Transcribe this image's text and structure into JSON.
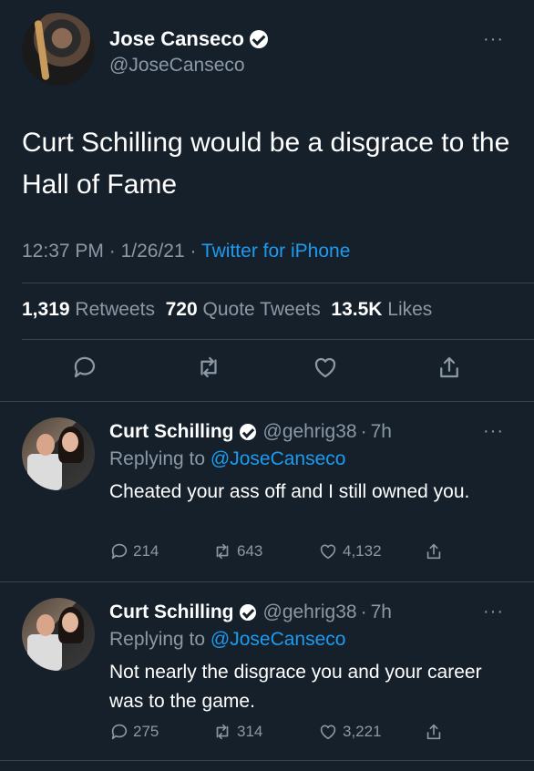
{
  "main_tweet": {
    "author_name": "Jose Canseco",
    "author_handle": "@JoseCanseco",
    "text": "Curt Schilling would be a disgrace to the Hall of Fame",
    "time": "12:37 PM",
    "date": "1/26/21",
    "source": "Twitter for iPhone",
    "separator": "·",
    "stats": {
      "retweets_count": "1,319",
      "retweets_label": "Retweets",
      "quotes_count": "720",
      "quotes_label": "Quote Tweets",
      "likes_count": "13.5K",
      "likes_label": "Likes"
    }
  },
  "replies": [
    {
      "author_name": "Curt Schilling",
      "author_handle": "@gehrig38",
      "age": "7h",
      "replying_prefix": "Replying to",
      "replying_to": "@JoseCanseco",
      "text": "Cheated your ass off and I still owned you.",
      "replies": "214",
      "retweets": "643",
      "likes": "4,132"
    },
    {
      "author_name": "Curt Schilling",
      "author_handle": "@gehrig38",
      "age": "7h",
      "replying_prefix": "Replying to",
      "replying_to": "@JoseCanseco",
      "text": "Not nearly the disgrace you and your career was to the game.",
      "replies": "275",
      "retweets": "314",
      "likes": "3,221"
    }
  ],
  "more_glyph": "···",
  "colors": {
    "background": "#15202b",
    "text": "#ffffff",
    "muted": "#8b98a5",
    "link": "#1d9bf0",
    "divider": "#38444d"
  },
  "icons": [
    "reply-icon",
    "retweet-icon",
    "like-icon",
    "share-icon",
    "verified-badge-icon",
    "more-icon"
  ]
}
